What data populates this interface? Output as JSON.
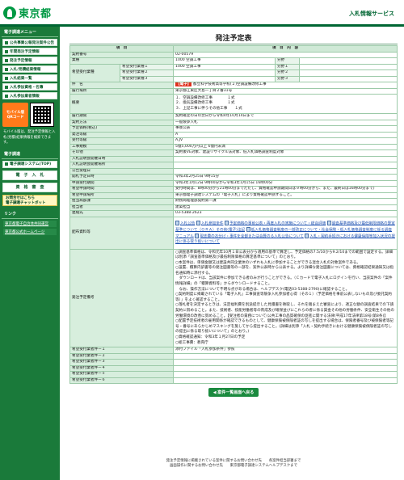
{
  "header": {
    "logo_text": "東京都",
    "site_name": "入札情報サービス"
  },
  "sidebar": {
    "head1": "電子調達メニュー",
    "menu": [
      "公共事業公報発注案件公告",
      "年間発注予定情報",
      "発注予定情報",
      "入札/見積結果情報",
      "入札結果一覧",
      "入札参加資格・名簿",
      "入札参加業者情報"
    ],
    "mobile": {
      "tag_line1": "モバイル版",
      "tag_line2": "QRコード"
    },
    "note": "モバイル版は、発注予定情報と入札(見積)結果情報を検索できます。",
    "head2": "電子調達",
    "links2": [
      "電子調達システム(TOP)",
      "電　子　入　札",
      "資　格　審　査"
    ],
    "yellow_line1": "お問合せはこちら",
    "yellow_line2": "電子調達チャットボット",
    "head3": "リンク",
    "ext_links": [
      "東京都電子自治体共同運営",
      "東京都公式ホームページ"
    ]
  },
  "main": {
    "title": "発注予定表",
    "col_item": "項　目",
    "col_content": "項　目　内　容",
    "contract_no": {
      "label": "契約番号",
      "value": "02-00579"
    },
    "project": {
      "label": "業種",
      "value": "1000 空調工事"
    },
    "desired": {
      "label": "希望受付業種",
      "rows": [
        {
          "sub": "希望受付業種１",
          "value": "1000 空調工事"
        },
        {
          "sub": "希望受付業種２",
          "value": ""
        },
        {
          "sub": "希望受付業種３",
          "value": ""
        }
      ],
      "tags": [
        "分野",
        "分野１",
        "分野２",
        "分野３"
      ]
    },
    "subject": {
      "label": "件　名",
      "tag": "【電子】",
      "value": "都立科学技術高等学校(２)空調設備改修工事"
    },
    "location": {
      "label": "履行場所",
      "value": "東京都江東区大島一丁目２番31号"
    },
    "outline": {
      "label": "概要",
      "lines": [
        "１．空調設備改修工事　　　　１式",
        "２．換気設備改修工事　　　　１式",
        "３．上記工事に伴うその他工事　　１式"
      ]
    },
    "period": {
      "label": "履行期間",
      "value": "契約確定の日の翌日から令和4年10月14日まで"
    },
    "method": {
      "label": "契約方法",
      "value": "一般競争入札"
    },
    "tax": {
      "label": "予定価格(税込)",
      "value": "事後公表"
    },
    "grade": {
      "label": "発注等級",
      "value": "A"
    },
    "jv": {
      "label": "受付等級",
      "value": "A,JV"
    },
    "scale": {
      "label": "工事規模",
      "value": "5億5,000万円以上 6億円未満"
    },
    "other": {
      "label": "その他",
      "value": "契約後VE対象、建設リサイクル法対象、低入札価格調査制度対象"
    },
    "empty_rows": [
      "入札説明会開催日時",
      "入札説明会開催場所",
      "公告受理日"
    ],
    "opening": {
      "label": "開札予定日時",
      "value": "令和3年2月25日 9時15分"
    },
    "apply_period": {
      "label": "申請受付期間",
      "value": "令和3年1月12日 9時00分から令和3年1月15日 16時00分"
    },
    "apply_time": {
      "label": "希望申請時間",
      "value": "受付時間は、8時00分から21時00分までただし、資格確認申請期間日は９時00分から、また、最終日は16時00分まで)"
    },
    "apply_place": {
      "label": "希望申請場所",
      "value": "東京都電子調達システムの「電子入札」により資格確認申請すること。"
    },
    "dept": {
      "label": "担当局部課",
      "value": "財務局経理部契約第一課"
    },
    "person": {
      "label": "担当者",
      "value": "建築担当"
    },
    "phone": {
      "label": "連絡先",
      "value": "03-5388-2623"
    },
    "docs": {
      "label": "配布資料等",
      "links": [
        "入札公告",
        "入札参加条件",
        "予定価格の事前公表・再度入札の実施について・総合評価",
        "調査基準価格及び最低制限価格の算定基準について（ＯＲＡ）その他(電子)注記",
        "低入札価格調査制度の一部改正について・社会保険・低入札価格調査制度に係る調査マニュアル",
        "現支費のお分け・事件を全部または合算のる入札公告について",
        "入札・契約手続きにおける健康保険等加入状況の提出に係る取り扱いについて"
      ]
    },
    "remarks": {
      "label": "発注予定備考",
      "lines": [
        "○調査基準価格は、令和元年10月１日公表分から適用の基準で算定し、予定価格の7.5/10から9.2/10までの範囲で設定する。詳細は別添「調査基準価格及び最低制限価格の算定基準について」のとおり。",
        "○本案件は、単価金額又は建設共同企業体のいずれも入札に参加することができる混合入札の対象案件である。",
        "○設置、積算内訳書等の発注図書等の一部を、案件公表時から公表する。より詳細な発注図書については、資格確認結果通知又は指名通知時に添付する。",
        "　ダウンロードは、当該案件に参加できる者のみが行うことができる。（Ｃカードで電子入札にログインを行い、当該案件の「案件情報詳細」の「積算資料等」からダウンロードすること。",
        "　なお、操作方法について不明な点がある場合は、ヘルプデスク(電話03-5388-2790)に確認すること。",
        "○契約制度に掲載されている「電子入札」工事調査等競争入札参加者心得（その１）（予定価格を事前公表しないもの及び委託契約等）」をよく確認すること。",
        "○落札者を決定するときは、法定福利費を別途提示した見積書を徴取し、それを踏まえた審査により、適正な額の調査結果での下請契約に努めること。また、技術者、技能労働者等の育成及び確保並びにこれらの者に係る賃金その他の労働条件、安全衛生その他の労働環境の改善に努めること。【受注者の責務について(公共工事の品質確保の促進に関する法律(平成17年法律第18号)第8条)】",
        "○配置予定技術者の雇用関係が確認できるものとして、健康保険被保険者証の写しを提出する場合は、保険者番号及び被保険者等記号・番号にあらかじめマスキングを施してから提出すること。(詳細は別添「入札・契約手続きにおける健康保険被保険者証の写しの提出に係る取り扱いについて」のとおり。)",
        "○資格確認通知：令和3年１月27日の予定",
        "○総工事費：教育庁"
      ]
    },
    "applicant_rows": [
      {
        "label": "希望受付業者件ー１",
        "value": "添付ファイル「入札参加条件」参照"
      },
      {
        "label": "希望受付業者件ー２",
        "value": ""
      },
      {
        "label": "希望受付業者件ー３",
        "value": ""
      },
      {
        "label": "希望受付業者件ー４",
        "value": ""
      },
      {
        "label": "希望受付業者件ー５",
        "value": ""
      },
      {
        "label": "希望受付業者件ー６",
        "value": ""
      }
    ],
    "back_button": "◀ 案件一覧画面へ戻る"
  },
  "footer": {
    "line1": "発注予定情報に掲載されている案件に関するお問い合わせ先　　各案件担当部署まで",
    "line2": "画面操作に関するお問い合わせ先　　東京都電子調達システムヘルプデスクまで"
  }
}
